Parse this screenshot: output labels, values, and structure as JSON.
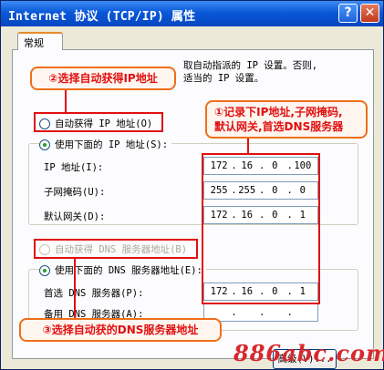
{
  "window": {
    "title": "Internet 协议 (TCP/IP) 属性",
    "help_glyph": "?",
    "close_glyph": "✕"
  },
  "tab": {
    "label": "常规"
  },
  "intro_text": {
    "line1": "取自动指派的 IP 设置。否则,",
    "line2": "适当的 IP 设置。"
  },
  "ip_section": {
    "auto_radio_label": "自动获得 IP 地址(O)",
    "manual_radio_label": "使用下面的 IP 地址(S):",
    "selected": "manual",
    "fields": [
      {
        "label": "IP 地址(I):",
        "octets": [
          "172",
          "16",
          "0",
          "100"
        ]
      },
      {
        "label": "子网掩码(U):",
        "octets": [
          "255",
          "255",
          "0",
          "0"
        ]
      },
      {
        "label": "默认网关(D):",
        "octets": [
          "172",
          "16",
          "0",
          "1"
        ]
      }
    ]
  },
  "dns_section": {
    "auto_radio_label": "自动获得 DNS 服务器地址(B)",
    "manual_radio_label": "使用下面的 DNS 服务器地址(E):",
    "selected": "manual",
    "fields": [
      {
        "label": "首选 DNS 服务器(P):",
        "octets": [
          "172",
          "16",
          "0",
          "1"
        ]
      },
      {
        "label": "备用 DNS 服务器(A):",
        "octets": [
          "",
          "",
          "",
          ""
        ]
      }
    ]
  },
  "annotations": {
    "callout_1": {
      "line1": "①记录下IP地址,子网掩码,",
      "line2": "默认网关,首选DNS服务器"
    },
    "callout_2": "②选择自动获得IP地址",
    "callout_3": "③选择自动获的DNS服务器地址",
    "color": "#e01010"
  },
  "buttons": {
    "advanced": "高级(V)..."
  },
  "watermark": "886abc.com"
}
